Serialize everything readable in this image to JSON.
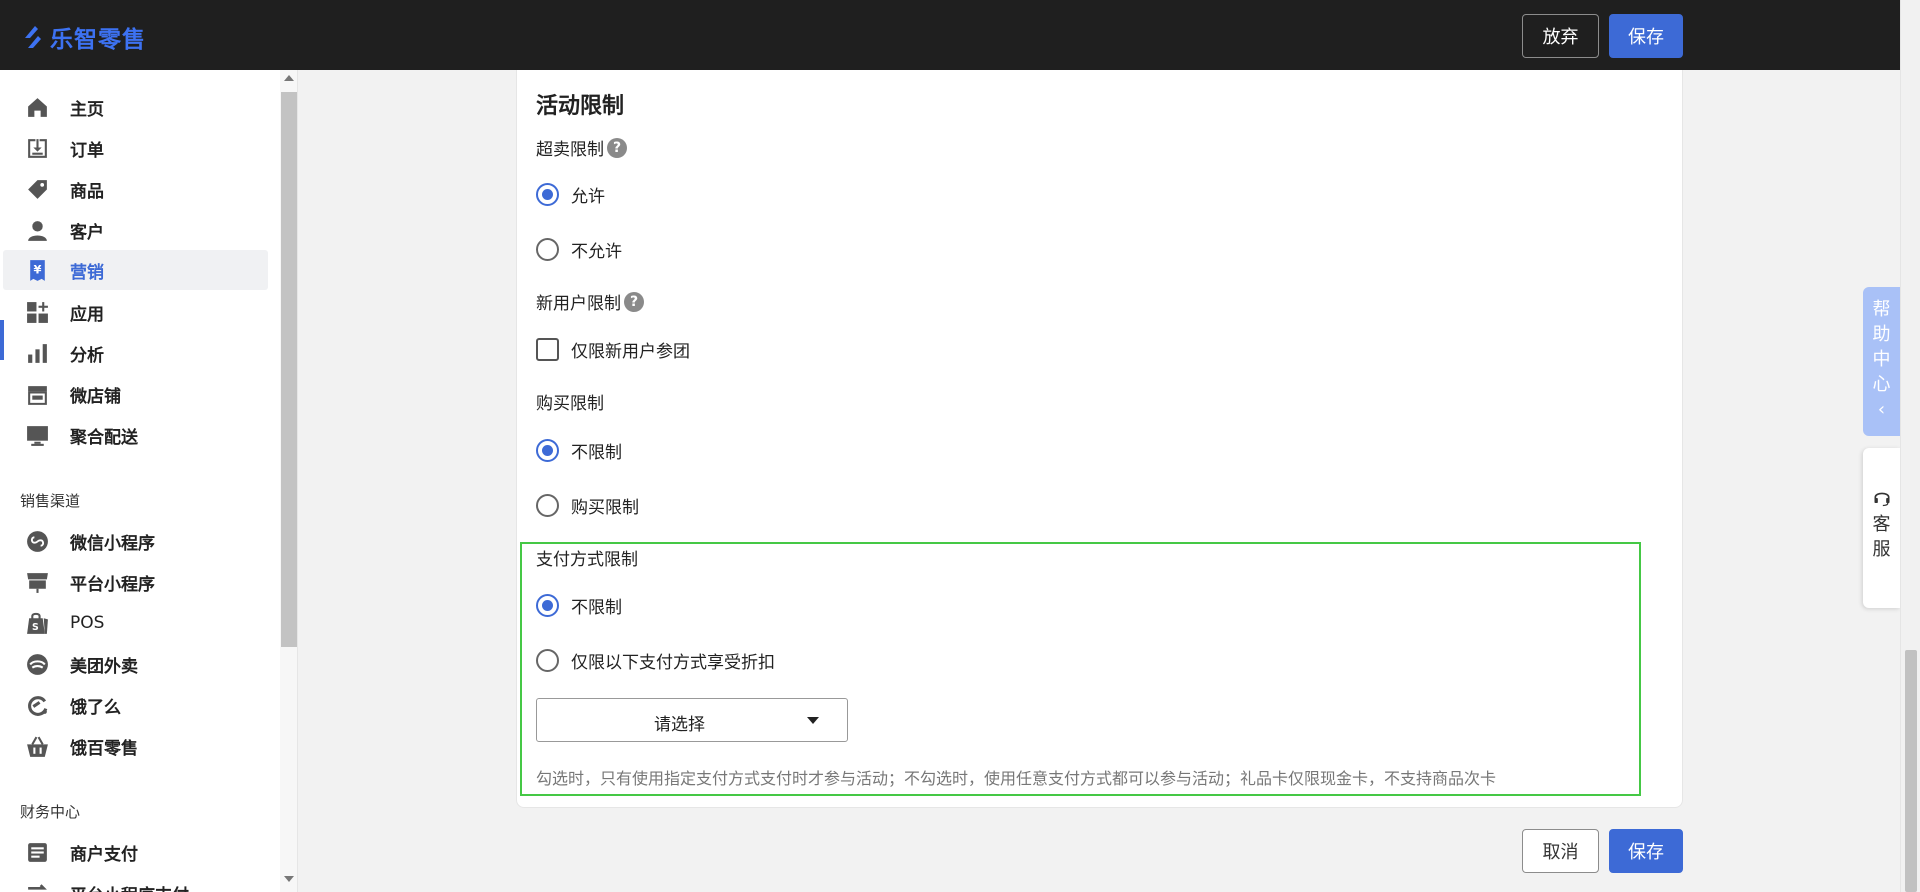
{
  "app": {
    "logo_text": "乐智零售"
  },
  "topbar": {
    "discard_label": "放弃",
    "save_label": "保存"
  },
  "sidebar": {
    "items": [
      {
        "label": "主页",
        "icon": "home-icon"
      },
      {
        "label": "订单",
        "icon": "order-download-icon"
      },
      {
        "label": "商品",
        "icon": "tag-icon"
      },
      {
        "label": "客户",
        "icon": "user-icon"
      },
      {
        "label": "营销",
        "icon": "yen-ticket-icon",
        "active": true
      },
      {
        "label": "应用",
        "icon": "apps-icon"
      },
      {
        "label": "分析",
        "icon": "bar-chart-icon"
      },
      {
        "label": "微店铺",
        "icon": "store-icon"
      },
      {
        "label": "聚合配送",
        "icon": "monitor-icon"
      }
    ],
    "section_sales": "销售渠道",
    "channels": [
      {
        "label": "微信小程序",
        "icon": "mini-program-icon"
      },
      {
        "label": "平台小程序",
        "icon": "platform-store-icon"
      },
      {
        "label": "POS",
        "icon": "pos-bag-icon"
      },
      {
        "label": "美团外卖",
        "icon": "meituan-icon"
      },
      {
        "label": "饿了么",
        "icon": "eleme-icon"
      },
      {
        "label": "饿百零售",
        "icon": "basket-icon"
      }
    ],
    "section_finance": "财务中心",
    "finance": [
      {
        "label": "商户支付",
        "icon": "document-list-icon"
      },
      {
        "label": "平台小程序支付",
        "icon": "transfer-icon"
      }
    ]
  },
  "card": {
    "title": "活动限制",
    "oversell": {
      "label": "超卖限制",
      "options": [
        "允许",
        "不允许"
      ],
      "selected": 0
    },
    "new_user": {
      "label": "新用户限制",
      "checkbox_label": "仅限新用户参团",
      "checked": false
    },
    "purchase": {
      "label": "购买限制",
      "options": [
        "不限制",
        "购买限制"
      ],
      "selected": 0
    },
    "payment": {
      "label": "支付方式限制",
      "options": [
        "不限制",
        "仅限以下支付方式享受折扣"
      ],
      "selected": 0,
      "select_placeholder": "请选择",
      "hint": "勾选时，只有使用指定支付方式支付时才参与活动；不勾选时，使用任意支付方式都可以参与活动；礼品卡仅限现金卡，不支持商品次卡"
    }
  },
  "footer": {
    "cancel_label": "取消",
    "save_label": "保存"
  },
  "float": {
    "help_chars": [
      "帮",
      "助",
      "中",
      "心",
      "‹"
    ],
    "service_chars": [
      "客",
      "服"
    ]
  },
  "colors": {
    "accent": "#3d6ad6",
    "highlight_border": "#45c845",
    "help_tab": "#a9c1f7"
  }
}
